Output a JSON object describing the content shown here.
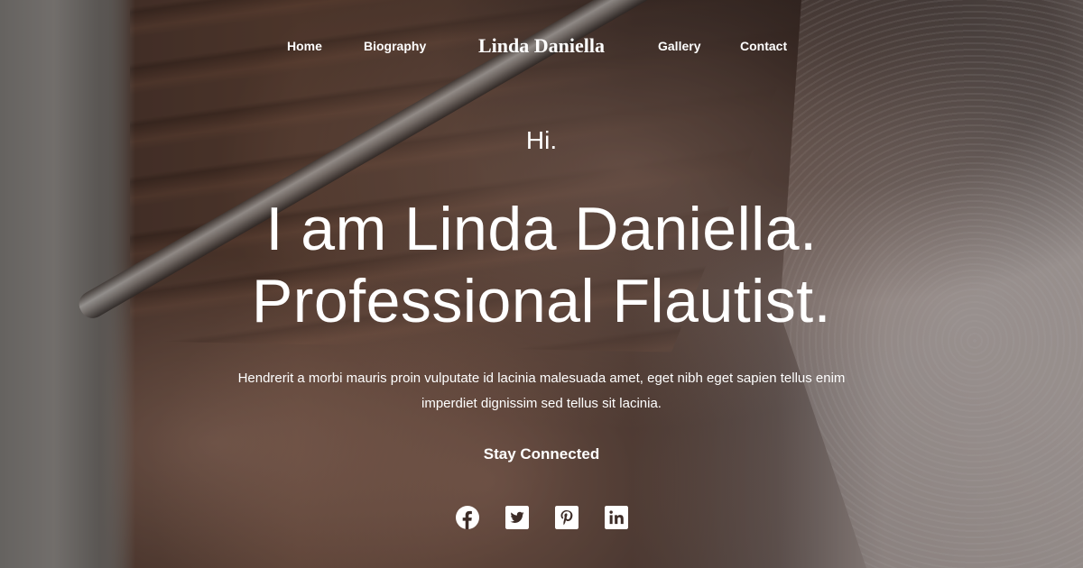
{
  "nav": {
    "links": [
      "Home",
      "Biography",
      "Gallery",
      "Contact"
    ],
    "brand": "Linda Daniella"
  },
  "hero": {
    "greeting": "Hi.",
    "headline_line1": "I am Linda Daniella.",
    "headline_line2": "Professional Flautist.",
    "description": "Hendrerit a morbi mauris proin vulputate id lacinia malesuada amet, eget nibh eget sapien tellus enim imperdiet dignissim sed tellus sit lacinia.",
    "stay_connected": "Stay Connected"
  },
  "socials": [
    {
      "icon": "facebook-icon"
    },
    {
      "icon": "twitter-icon"
    },
    {
      "icon": "pinterest-icon"
    },
    {
      "icon": "linkedin-icon"
    }
  ],
  "colors": {
    "text": "#ffffff",
    "overlay": "rgba(0,0,0,0.28)"
  }
}
